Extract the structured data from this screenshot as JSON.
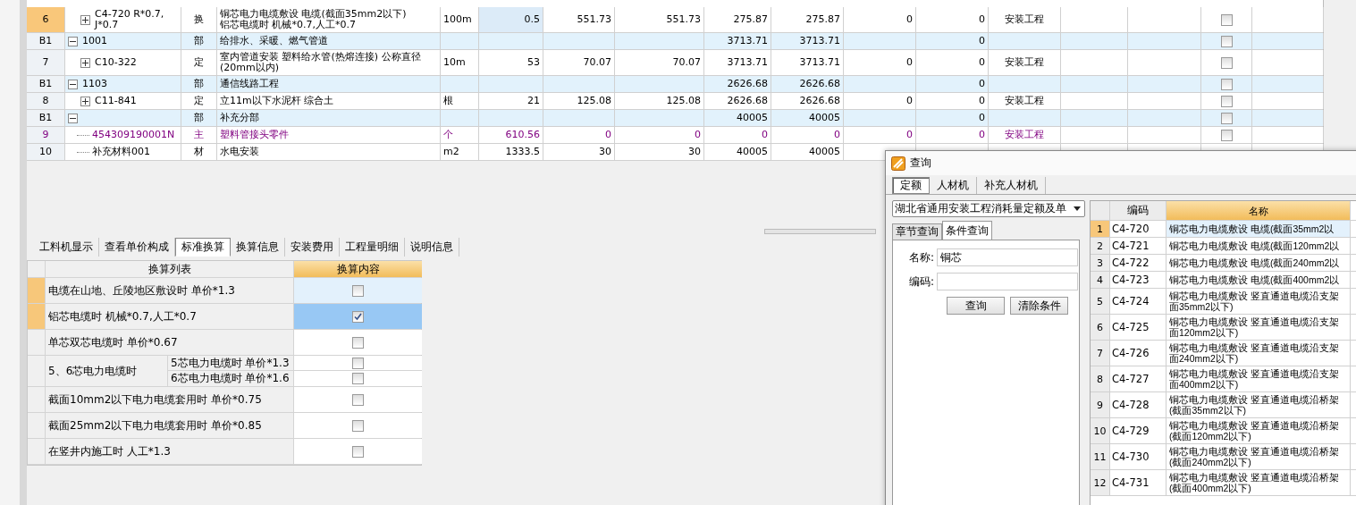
{
  "grid": {
    "rows": [
      {
        "kind": "item",
        "num": "6",
        "selected": true,
        "expandable": true,
        "expanded": false,
        "code": "C4-720 R*0.7,\nJ*0.7",
        "type": "换",
        "name": "铜芯电力电缆敷设 电缆(截面35mm2以下)\n铝芯电缆时 机械*0.7,人工*0.7",
        "unit": "100m",
        "qty": "0.5",
        "price": "551.73",
        "price2": "551.73",
        "total": "275.87",
        "total2": "275.87",
        "c1": "0",
        "c2": "0",
        "category": "安装工程",
        "checked": false
      },
      {
        "kind": "section",
        "num": "B1",
        "selected": false,
        "expandable": true,
        "expanded": true,
        "code": "1001",
        "type": "部",
        "name": "给排水、采暖、燃气管道",
        "unit": "",
        "qty": "",
        "price": "",
        "price2": "",
        "total": "3713.71",
        "total2": "3713.71",
        "c1": "",
        "c2": "0",
        "category": "",
        "checked": false
      },
      {
        "kind": "item",
        "num": "7",
        "selected": false,
        "expandable": true,
        "expanded": false,
        "code": "C10-322",
        "type": "定",
        "name": "室内管道安装 塑料给水管(热熔连接) 公称直径(20mm以内)",
        "unit": "10m",
        "qty": "53",
        "price": "70.07",
        "price2": "70.07",
        "total": "3713.71",
        "total2": "3713.71",
        "c1": "0",
        "c2": "0",
        "category": "安装工程",
        "checked": false
      },
      {
        "kind": "section",
        "num": "B1",
        "selected": false,
        "expandable": true,
        "expanded": true,
        "code": "1103",
        "type": "部",
        "name": "通信线路工程",
        "unit": "",
        "qty": "",
        "price": "",
        "price2": "",
        "total": "2626.68",
        "total2": "2626.68",
        "c1": "",
        "c2": "0",
        "category": "",
        "checked": false
      },
      {
        "kind": "item",
        "num": "8",
        "selected": false,
        "expandable": true,
        "expanded": false,
        "code": "C11-841",
        "type": "定",
        "name": "立11m以下水泥杆 综合土",
        "unit": "根",
        "qty": "21",
        "price": "125.08",
        "price2": "125.08",
        "total": "2626.68",
        "total2": "2626.68",
        "c1": "0",
        "c2": "0",
        "category": "安装工程",
        "checked": false
      },
      {
        "kind": "section",
        "num": "B1",
        "selected": false,
        "expandable": true,
        "expanded": true,
        "code": "",
        "type": "部",
        "name": "补充分部",
        "unit": "",
        "qty": "",
        "price": "",
        "price2": "",
        "total": "40005",
        "total2": "40005",
        "c1": "",
        "c2": "0",
        "category": "",
        "checked": false
      },
      {
        "kind": "material",
        "num": "9",
        "selected": false,
        "expandable": false,
        "code": "454309190001N",
        "type": "主",
        "name": "塑料管接头零件",
        "unit": "个",
        "qty": "610.56",
        "price": "0",
        "price2": "0",
        "total": "0",
        "total2": "0",
        "c1": "0",
        "c2": "0",
        "category": "安装工程",
        "checked": false
      },
      {
        "kind": "item",
        "num": "10",
        "selected": false,
        "expandable": false,
        "code": "补充材料001",
        "type": "材",
        "name": "水电安装",
        "unit": "m2",
        "qty": "1333.5",
        "price": "30",
        "price2": "30",
        "total": "40005",
        "total2": "40005",
        "c1": "",
        "c2": "",
        "category": ""
      }
    ]
  },
  "bottom_tabs": [
    {
      "label": "工料机显示",
      "selected": false
    },
    {
      "label": "查看单价构成",
      "selected": false
    },
    {
      "label": "标准换算",
      "selected": true
    },
    {
      "label": "换算信息",
      "selected": false
    },
    {
      "label": "安装费用",
      "selected": false
    },
    {
      "label": "工程量明细",
      "selected": false
    },
    {
      "label": "说明信息",
      "selected": false
    }
  ],
  "conversion": {
    "columns": [
      "换算列表",
      "换算内容"
    ],
    "rows": [
      {
        "kind": "single",
        "text": "电缆在山地、丘陵地区敷设时 单价*1.3",
        "marked": true,
        "selected": false,
        "checked": false
      },
      {
        "kind": "single",
        "text": "铝芯电缆时 机械*0.7,人工*0.7",
        "marked": true,
        "selected": true,
        "checked": true
      },
      {
        "kind": "single",
        "text": "单芯双芯电缆时 单价*0.67",
        "marked": false,
        "selected": false,
        "checked": false
      },
      {
        "kind": "group",
        "text": "5、6芯电力电缆时",
        "marked": false,
        "selected": false,
        "options": [
          {
            "text": "5芯电力电缆时 单价*1.3",
            "checked": false
          },
          {
            "text": "6芯电力电缆时 单价*1.6",
            "checked": false
          }
        ]
      },
      {
        "kind": "single",
        "text": "截面10mm2以下电力电缆套用时 单价*0.75",
        "marked": false,
        "selected": false,
        "checked": false
      },
      {
        "kind": "single",
        "text": "截面25mm2以下电力电缆套用时 单价*0.85",
        "marked": false,
        "selected": false,
        "checked": false
      },
      {
        "kind": "single",
        "text": "在竖井内施工时 人工*1.3",
        "marked": false,
        "selected": false,
        "checked": false
      }
    ]
  },
  "dialog": {
    "title": "查询",
    "tabs": [
      {
        "label": "定额",
        "selected": true
      },
      {
        "label": "人材机",
        "selected": false
      },
      {
        "label": "补充人材机",
        "selected": false
      }
    ],
    "library": "湖北省通用安装工程消耗量定额及单",
    "subtabs": [
      {
        "label": "章节查询",
        "selected": false
      },
      {
        "label": "条件查询",
        "selected": true
      }
    ],
    "fields": [
      {
        "label": "名称:",
        "value": "铜芯"
      },
      {
        "label": "编码:"
      }
    ],
    "buttons": [
      "查询",
      "清除条件"
    ],
    "columns": [
      "编码",
      "名称"
    ],
    "rows": [
      {
        "num": "1",
        "code": "C4-720",
        "name": "铜芯电力电缆敷设 电缆(截面35mm2以",
        "selected": true
      },
      {
        "num": "2",
        "code": "C4-721",
        "name": "铜芯电力电缆敷设 电缆(截面120mm2以",
        "selected": false
      },
      {
        "num": "3",
        "code": "C4-722",
        "name": "铜芯电力电缆敷设 电缆(截面240mm2以",
        "selected": false
      },
      {
        "num": "4",
        "code": "C4-723",
        "name": "铜芯电力电缆敷设 电缆(截面400mm2以",
        "selected": false
      },
      {
        "num": "5",
        "code": "C4-724",
        "name": "铜芯电力电缆敷设 竖直通道电缆沿支架面35mm2以下)",
        "selected": false
      },
      {
        "num": "6",
        "code": "C4-725",
        "name": "铜芯电力电缆敷设 竖直通道电缆沿支架面120mm2以下)",
        "selected": false
      },
      {
        "num": "7",
        "code": "C4-726",
        "name": "铜芯电力电缆敷设 竖直通道电缆沿支架面240mm2以下)",
        "selected": false
      },
      {
        "num": "8",
        "code": "C4-727",
        "name": "铜芯电力电缆敷设 竖直通道电缆沿支架面400mm2以下)",
        "selected": false
      },
      {
        "num": "9",
        "code": "C4-728",
        "name": "铜芯电力电缆敷设 竖直通道电缆沿桥架(截面35mm2以下)",
        "selected": false
      },
      {
        "num": "10",
        "code": "C4-729",
        "name": "铜芯电力电缆敷设 竖直通道电缆沿桥架(截面120mm2以下)",
        "selected": false
      },
      {
        "num": "11",
        "code": "C4-730",
        "name": "铜芯电力电缆敷设 竖直通道电缆沿桥架(截面240mm2以下)",
        "selected": false
      },
      {
        "num": "12",
        "code": "C4-731",
        "name": "铜芯电力电缆敷设 竖直通道电缆沿桥架(截面400mm2以下)",
        "selected": false
      }
    ]
  }
}
